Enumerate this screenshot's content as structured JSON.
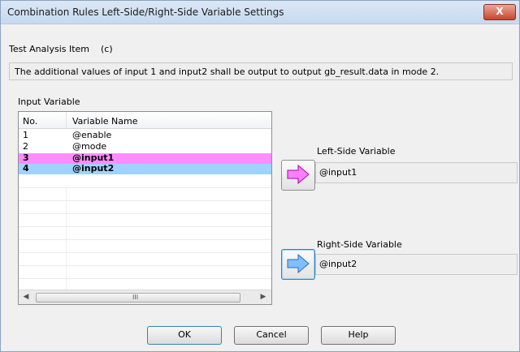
{
  "window": {
    "title": "Combination Rules Left-Side/Right-Side Variable Settings",
    "close_glyph": "X"
  },
  "analysis": {
    "label": "Test Analysis Item",
    "value": "(c)"
  },
  "description": "The additional values of input 1 and input2 shall be output to output gb_result.data in mode 2.",
  "input_variable": {
    "label": "Input Variable",
    "columns": [
      "No.",
      "Variable Name"
    ],
    "rows": [
      {
        "no": "1",
        "name": "@enable"
      },
      {
        "no": "2",
        "name": "@mode"
      },
      {
        "no": "3",
        "name": "@input1"
      },
      {
        "no": "4",
        "name": "@input2"
      }
    ],
    "row_highlight_colors": [
      "",
      "",
      "#ff8cff",
      "#9fd3ff"
    ],
    "scrollbar_grip": "III"
  },
  "left_side": {
    "label": "Left-Side Variable",
    "value": "@input1",
    "arrow_color": "#ff7fff",
    "icon": "right-arrow-icon"
  },
  "right_side": {
    "label": "Right-Side Variable",
    "value": "@input2",
    "arrow_color": "#7fbfff",
    "icon": "right-arrow-icon"
  },
  "buttons": {
    "ok": "OK",
    "cancel": "Cancel",
    "help": "Help"
  }
}
